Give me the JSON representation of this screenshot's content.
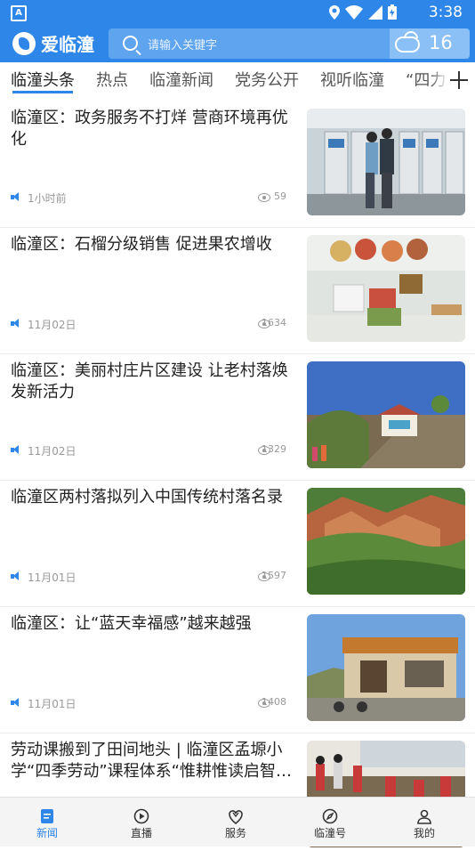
{
  "status_bar": {
    "time": "3:38",
    "notification_letter": "A"
  },
  "header": {
    "app_name": "爱临潼",
    "search_placeholder": "请输入关键字",
    "temperature": "16",
    "weather_icon": "cloud-icon"
  },
  "tabs": [
    {
      "label": "临潼头条",
      "active": true
    },
    {
      "label": "热点"
    },
    {
      "label": "临潼新闻"
    },
    {
      "label": "党务公开"
    },
    {
      "label": "视听临潼"
    },
    {
      "label": "“四力"
    }
  ],
  "articles": [
    {
      "title": "临潼区：政务服务不打烊 营商环境再优化",
      "date": "1小时前",
      "views": "59"
    },
    {
      "title": "临潼区：石榴分级销售 促进果农增收",
      "date": "11月02日",
      "views": "1634"
    },
    {
      "title": "临潼区：美丽村庄片区建设 让老村落焕发新活力",
      "date": "11月02日",
      "views": "1329"
    },
    {
      "title": "临潼区两村落拟列入中国传统村落名录",
      "date": "11月01日",
      "views": "1597"
    },
    {
      "title": "临潼区：让“蓝天幸福感”越来越强",
      "date": "11月01日",
      "views": "1408"
    },
    {
      "title": "劳动课搬到了田间地头 | 临潼区孟塬小学“四季劳动”课程体系“惟耕惟读启智…",
      "date": "",
      "views": ""
    }
  ],
  "bottom_nav": [
    {
      "label": "新闻",
      "active": true,
      "icon": "news-icon"
    },
    {
      "label": "直播",
      "icon": "live-icon"
    },
    {
      "label": "服务",
      "icon": "service-icon"
    },
    {
      "label": "临潼号",
      "icon": "compass-icon"
    },
    {
      "label": "我的",
      "icon": "profile-icon"
    }
  ],
  "colors": {
    "brand": "#2e86e8",
    "text": "#222222",
    "meta": "#999999"
  }
}
